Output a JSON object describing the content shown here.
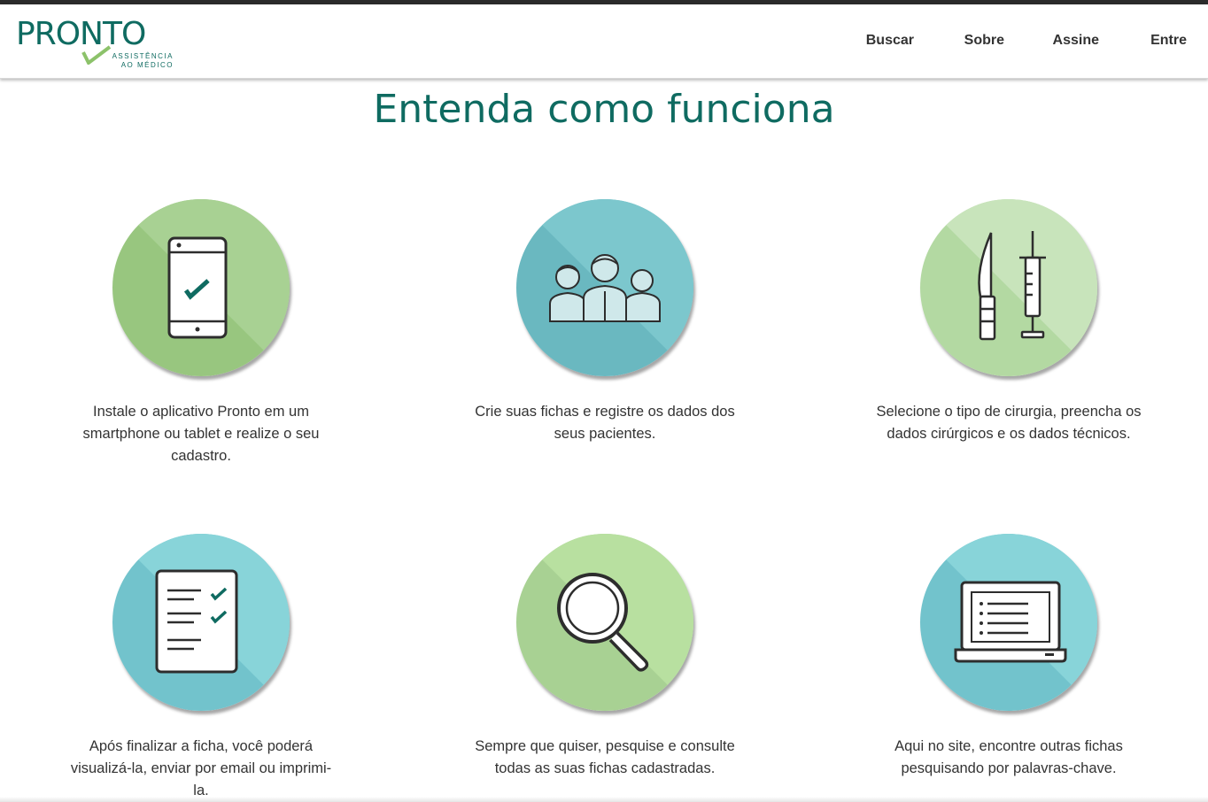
{
  "brand": {
    "name": "PRONTO",
    "tagline_line1": "ASSISTÊNCIA",
    "tagline_line2": "AO MÉDICO",
    "color": "#0f6b61",
    "check_color": "#8cc26a"
  },
  "nav": {
    "items": [
      {
        "label": "Buscar"
      },
      {
        "label": "Sobre"
      },
      {
        "label": "Assine"
      },
      {
        "label": "Entre"
      }
    ]
  },
  "main": {
    "title": "Entenda como funciona",
    "steps": [
      {
        "icon": "smartphone-check-icon",
        "text": "Instale o aplicativo Pronto em um smartphone ou tablet e realize o seu cadastro.",
        "colors": [
          "#98c67f",
          "#a8d193"
        ]
      },
      {
        "icon": "patients-group-icon",
        "text": "Crie suas fichas e registre os dados dos seus pacientes.",
        "colors": [
          "#6ab8c0",
          "#7cc7cd"
        ]
      },
      {
        "icon": "scalpel-syringe-icon",
        "text": "Selecione o tipo de cirurgia, preencha os dados cirúrgicos e os dados técnicos.",
        "colors": [
          "#b3d9a2",
          "#c8e4bb"
        ]
      },
      {
        "icon": "checklist-document-icon",
        "text": "Após finalizar a ficha, você poderá visualizá-la, enviar por email ou imprimi-la.",
        "colors": [
          "#72c3cc",
          "#88d4d9"
        ]
      },
      {
        "icon": "magnifier-icon",
        "text": "Sempre que quiser, pesquise e consulte todas as suas fichas cadastradas.",
        "colors": [
          "#a8d193",
          "#b8e0a0"
        ]
      },
      {
        "icon": "laptop-list-icon",
        "text": "Aqui no site, encontre outras fichas pesquisando por palavras-chave.",
        "colors": [
          "#72c3cc",
          "#88d4d9"
        ]
      }
    ]
  }
}
